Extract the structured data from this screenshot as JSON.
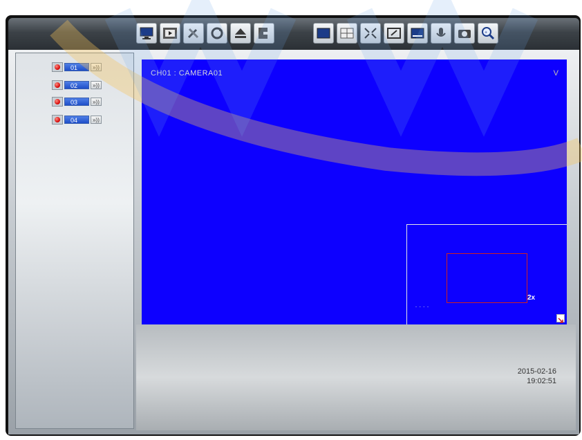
{
  "toolbar": {
    "left_buttons": [
      "monitor-icon",
      "playback-icon",
      "tools-icon",
      "refresh-icon",
      "eject-icon",
      "exit-icon"
    ],
    "right_buttons": [
      "single-view-icon",
      "quad-view-icon",
      "fullscreen-icon",
      "resize-icon",
      "screen-icon",
      "microphone-icon",
      "snapshot-icon",
      "zoom-icon"
    ]
  },
  "cameras": [
    {
      "num": "01",
      "audio": "»))"
    },
    {
      "num": "02",
      "audio": "»))"
    },
    {
      "num": "03",
      "audio": "»))"
    },
    {
      "num": "04",
      "audio": "»))"
    }
  ],
  "video": {
    "channel_label": "CH01 : CAMERA01",
    "indicator": "V",
    "zoom_label": "2x",
    "pip_dots": "- - - -"
  },
  "status": {
    "date": "2015-02-16",
    "time": "19:02:51"
  },
  "colors": {
    "video_bg": "#0d00ff",
    "pip_box": "#d02020",
    "camera_num_bg": "#1f4fc8"
  }
}
